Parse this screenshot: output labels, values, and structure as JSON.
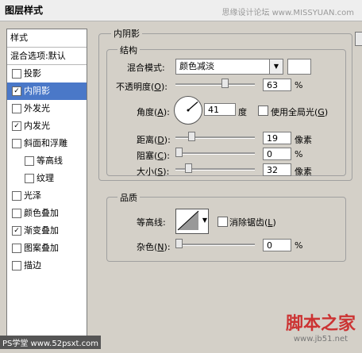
{
  "window": {
    "title": "图层样式",
    "watermark": "思缘设计论坛 www.MISSYUAN.com"
  },
  "sidebar": {
    "header": "样式",
    "blend_options": "混合选项:默认",
    "items": [
      {
        "label": "投影",
        "checked": false,
        "selected": false,
        "sub": false
      },
      {
        "label": "内阴影",
        "checked": true,
        "selected": true,
        "sub": false
      },
      {
        "label": "外发光",
        "checked": false,
        "selected": false,
        "sub": false
      },
      {
        "label": "内发光",
        "checked": true,
        "selected": false,
        "sub": false
      },
      {
        "label": "斜面和浮雕",
        "checked": false,
        "selected": false,
        "sub": false
      },
      {
        "label": "等高线",
        "checked": false,
        "selected": false,
        "sub": true
      },
      {
        "label": "纹理",
        "checked": false,
        "selected": false,
        "sub": true
      },
      {
        "label": "光泽",
        "checked": false,
        "selected": false,
        "sub": false
      },
      {
        "label": "颜色叠加",
        "checked": false,
        "selected": false,
        "sub": false
      },
      {
        "label": "渐变叠加",
        "checked": true,
        "selected": false,
        "sub": false
      },
      {
        "label": "图案叠加",
        "checked": false,
        "selected": false,
        "sub": false
      },
      {
        "label": "描边",
        "checked": false,
        "selected": false,
        "sub": false
      }
    ]
  },
  "inner_shadow": {
    "section_title": "内阴影",
    "structure_title": "结构",
    "blend_mode_label": "混合模式:",
    "blend_mode_value": "颜色减淡",
    "opacity_label": "不透明度(O):",
    "opacity_label_pre": "不透明度(",
    "opacity_key": "O",
    "opacity_value": "63",
    "opacity_unit": "%",
    "opacity_level": 0.63,
    "angle_label_pre": "角度(",
    "angle_key": "A",
    "angle_value": "41",
    "angle_unit": "度",
    "global_light_label_pre": "使用全局光(",
    "global_light_key": "G",
    "distance_label_pre": "距离(",
    "distance_key": "D",
    "distance_value": "19",
    "distance_unit": "像素",
    "choke_label_pre": "阻塞(",
    "choke_key": "C",
    "choke_value": "0",
    "choke_unit": "%",
    "size_label_pre": "大小(",
    "size_key": "S",
    "size_value": "32",
    "size_unit": "像素",
    "close_paren_colon": "):",
    "close_paren": ")"
  },
  "quality": {
    "title": "品质",
    "contour_label": "等高线:",
    "antialias_label_pre": "消除锯齿(",
    "antialias_key": "L",
    "noise_label_pre": "杂色(",
    "noise_key": "N",
    "noise_value": "0",
    "noise_unit": "%"
  },
  "footer": {
    "ps_mark": "PS学堂 www.52psxt.com",
    "site_big": "脚本之家",
    "site_small": "www.jb51.net"
  },
  "colors": {
    "selected_item": "#4a78c8",
    "dialog_bg": "#d4d0c8"
  }
}
